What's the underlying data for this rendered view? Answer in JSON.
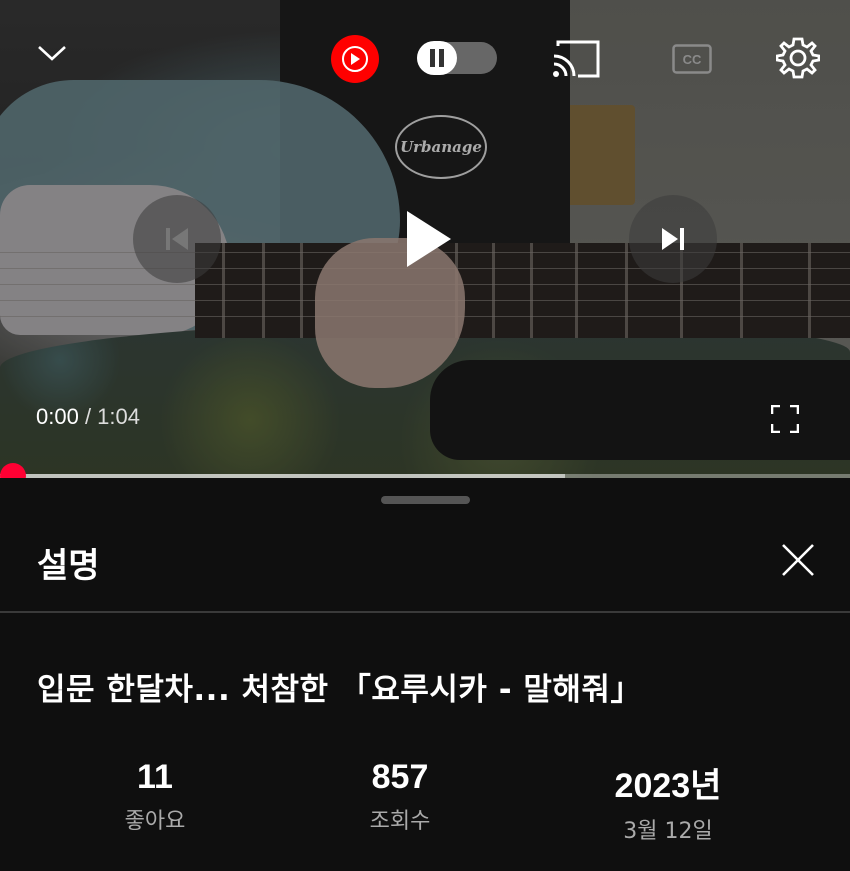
{
  "player": {
    "current_time": "0:00",
    "separator": " / ",
    "duration": "1:04",
    "progress_fraction": 0.0,
    "buffered_fraction": 0.665,
    "video_overlay_text": "Urbanage"
  },
  "colors": {
    "accent": "#ff0033",
    "music_badge": "#ff0000",
    "sheet_bg": "#0f0f0f",
    "secondary_text": "#aaaaaa"
  },
  "icons": {
    "collapse": "chevron-down-icon",
    "music": "youtube-music-icon",
    "autoplay": "pause-icon",
    "cast": "cast-icon",
    "captions": "cc-icon",
    "settings": "gear-icon",
    "previous": "skip-previous-icon",
    "play": "play-icon",
    "next": "skip-next-icon",
    "fullscreen": "fullscreen-icon",
    "close": "close-icon"
  },
  "description_panel": {
    "title": "설명",
    "video_title": "입문 한달차... 처참한 「요루시카 - 말해줘」",
    "stats": {
      "likes_value": "11",
      "likes_label": "좋아요",
      "views_value": "857",
      "views_label": "조회수",
      "year_value": "2023년",
      "date_label": "3월 12일"
    }
  }
}
